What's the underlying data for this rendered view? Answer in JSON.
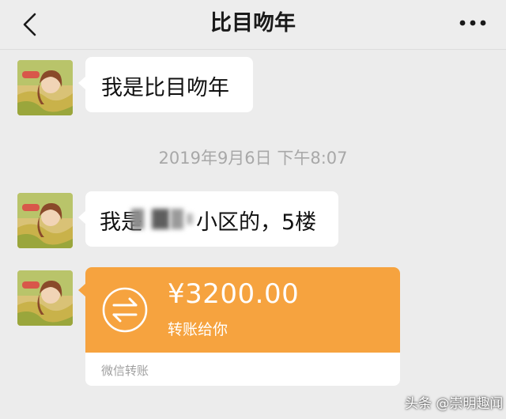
{
  "header": {
    "title": "比目吻年",
    "back_icon": "chevron-left-icon",
    "more_icon": "more-horizontal-icon"
  },
  "messages": [
    {
      "type": "text",
      "text": "我是比目吻年"
    },
    {
      "type": "timestamp",
      "text": "2019年9月6日 下午8:07"
    },
    {
      "type": "text",
      "text_before": "我是",
      "text_after": "小区的，5楼",
      "redacted": true
    },
    {
      "type": "transfer",
      "amount": "¥3200.00",
      "note": "转账给你",
      "footer": "微信转账",
      "icon": "transfer-arrows-icon",
      "color": "#f6a33f"
    }
  ],
  "watermark": "头条 @崇明趣闻"
}
